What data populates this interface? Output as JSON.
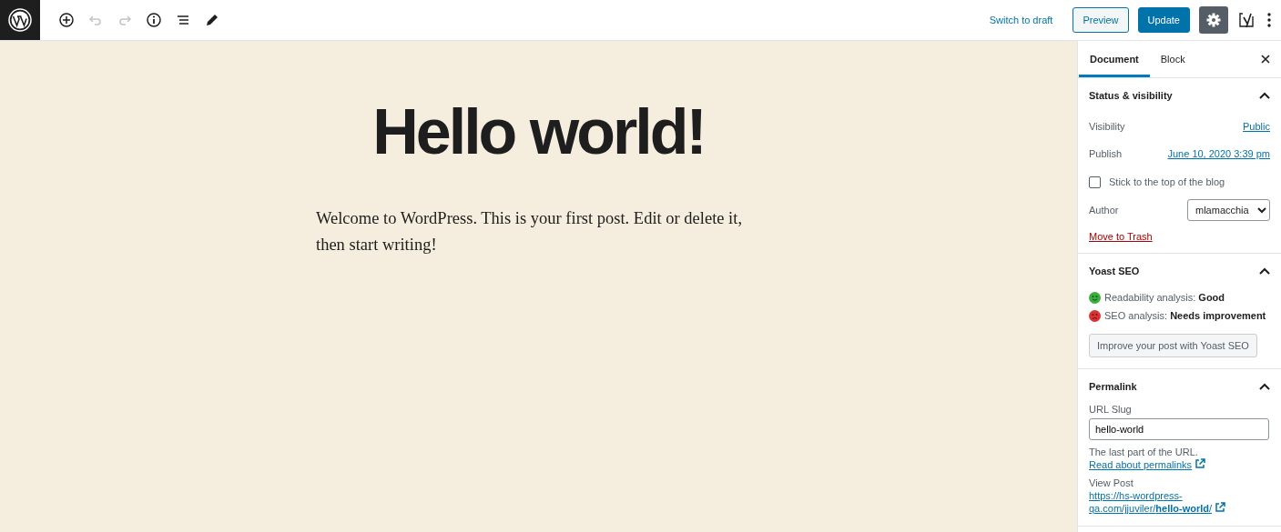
{
  "toolbar": {
    "undo_disabled": true,
    "redo_disabled": true,
    "switch_link": "Switch to draft",
    "preview": "Preview",
    "update": "Update",
    "settings_active": true
  },
  "post": {
    "title": "Hello world!",
    "body": "Welcome to WordPress. This is your first post. Edit or delete it, then start writing!"
  },
  "sidebar": {
    "tabs": [
      {
        "label": "Document",
        "selected": true
      },
      {
        "label": "Block",
        "selected": false
      }
    ],
    "panels": [
      {
        "kind": "status",
        "title": "Status & visibility",
        "expanded": true,
        "visibility_label": "Visibility",
        "visibility": "Public",
        "publish_label": "Publish",
        "publish": "June 10, 2020 3:39 pm",
        "sticky_label": "Stick to the top of the blog",
        "sticky_checked": false,
        "author_label": "Author",
        "author": "mlamacchia",
        "trash": "Move to Trash"
      },
      {
        "kind": "yoast",
        "title": "Yoast SEO",
        "expanded": true,
        "analyses": [
          {
            "text": "Readability analysis: **Good**",
            "color": "#3cae3c",
            "kind": "good"
          },
          {
            "text": "SEO analysis: **Needs improvement**",
            "color": "#dc3232",
            "kind": "bad"
          }
        ],
        "button": "Improve your post with Yoast SEO"
      },
      {
        "kind": "permalink",
        "title": "Permalink",
        "expanded": true,
        "slug_label": "URL Slug",
        "slug": "hello-world",
        "help": "The last part of the URL.",
        "help_link": "Read about permalinks",
        "view_label": "View Post",
        "url": "https://hs-wordpress-qa.com/jjuviler/**hello-world**/"
      }
    ]
  }
}
